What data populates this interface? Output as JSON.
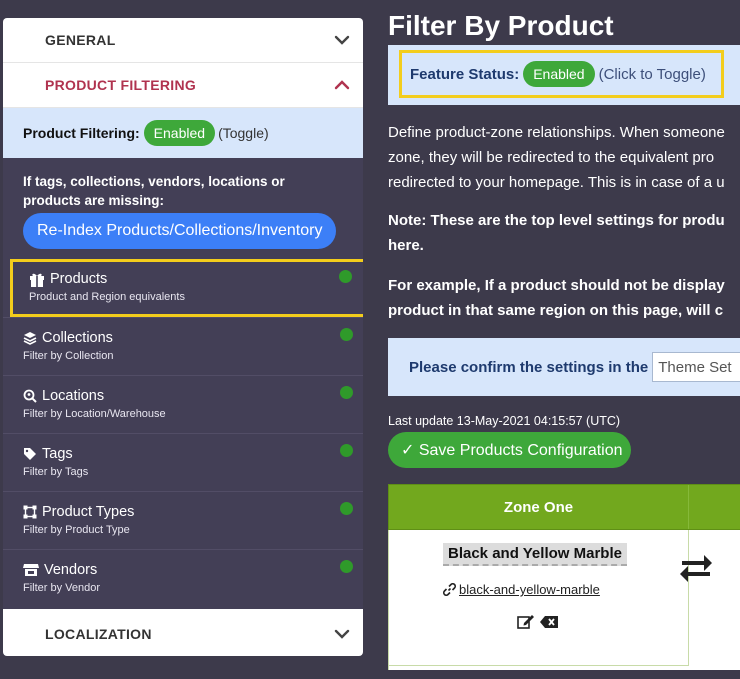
{
  "sidebar": {
    "general_label": "GENERAL",
    "product_filtering_label": "PRODUCT FILTERING",
    "pf_status": {
      "label": "Product Filtering:",
      "badge": "Enabled",
      "toggle": "(Toggle)"
    },
    "missing_text": "If tags, collections, vendors, locations or products are missing:",
    "reindex_label": "Re-Index Products/Collections/Inventory",
    "items": [
      {
        "title": "Products",
        "subtitle": "Product and Region equivalents",
        "icon": "gift-icon",
        "status": "active"
      },
      {
        "title": "Collections",
        "subtitle": "Filter by Collection",
        "icon": "layers-icon",
        "status": "active"
      },
      {
        "title": "Locations",
        "subtitle": "Filter by Location/Warehouse",
        "icon": "search-location-icon",
        "status": "active"
      },
      {
        "title": "Tags",
        "subtitle": "Filter by Tags",
        "icon": "tag-icon",
        "status": "active"
      },
      {
        "title": "Product Types",
        "subtitle": "Filter by Product Type",
        "icon": "vector-square-icon",
        "status": "active"
      },
      {
        "title": "Vendors",
        "subtitle": "Filter by Vendor",
        "icon": "store-icon",
        "status": "active"
      }
    ],
    "localization_label": "LOCALIZATION"
  },
  "main": {
    "title": "Filter By Product",
    "feature_status": {
      "label": "Feature Status:",
      "badge": "Enabled",
      "click": "(Click to Toggle)"
    },
    "description_lines": [
      "Define product-zone relationships. When someone",
      "zone, they will be redirected to the equivalent pro",
      "redirected to your homepage. This is in case of a u"
    ],
    "note_lines": [
      "Note: These are the top level settings for produ",
      "here."
    ],
    "example_lines": [
      "For example, If a product should not be display",
      "product in that same region on this page, will c"
    ],
    "confirm_text": "Please confirm the settings in the",
    "theme_input_value": "Theme Set",
    "last_update": "Last update 13-May-2021 04:15:57 (UTC)",
    "save_button": "✓ Save Products Configuration",
    "table": {
      "zone_one": "Zone One",
      "product_name": "Black and Yellow Marble",
      "product_handle": "black-and-yellow-marble"
    }
  },
  "colors": {
    "background": "#3d3a4b",
    "sidebar_dark": "#433f56",
    "accent_red": "#b0334f",
    "enabled_green": "#3ea83a",
    "reindex_blue": "#3c7ff7",
    "highlight_yellow": "#f3cd1c",
    "zone_header_green": "#72a81e",
    "info_blue": "#d7e6fb"
  }
}
